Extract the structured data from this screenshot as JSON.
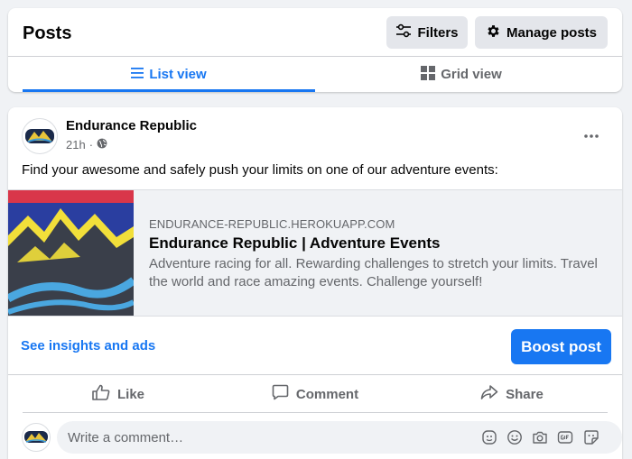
{
  "header": {
    "title": "Posts",
    "filters_label": "Filters",
    "manage_label": "Manage posts",
    "tabs": [
      {
        "label": "List view",
        "active": true
      },
      {
        "label": "Grid view",
        "active": false
      }
    ]
  },
  "post": {
    "page_name": "Endurance Republic",
    "time": "21h",
    "separator": "·",
    "audience_icon": "globe-icon",
    "text": "Find your awesome and safely push your limits on one of our adventure events:",
    "link": {
      "domain": "ENDURANCE-REPUBLIC.HEROKUAPP.COM",
      "title": "Endurance Republic | Adventure Events",
      "description": "Adventure racing for all. Rewarding challenges to stretch your limits. Travel the world and race amazing events. Challenge yourself!"
    },
    "insights_label": "See insights and ads",
    "boost_label": "Boost post",
    "actions": {
      "like": "Like",
      "comment": "Comment",
      "share": "Share"
    },
    "comment_placeholder": "Write a comment…",
    "comment_icons": [
      "avatar-sticker-icon",
      "emoji-icon",
      "camera-icon",
      "gif-icon",
      "sticker-icon"
    ]
  },
  "colors": {
    "accent": "#1877f2",
    "secondary_text": "#65676b",
    "background": "#f0f2f5"
  }
}
